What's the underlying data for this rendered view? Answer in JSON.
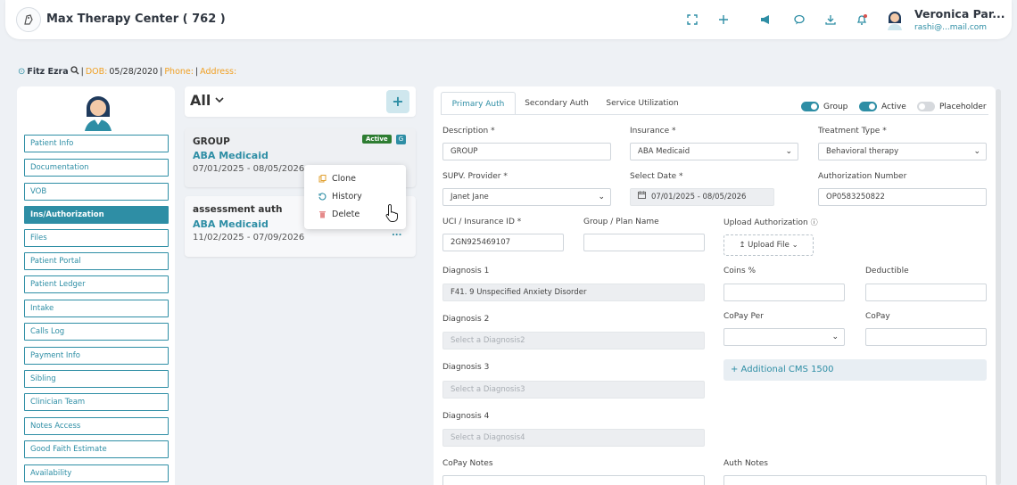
{
  "app": {
    "title": "Max Therapy Center ( 762 )"
  },
  "user": {
    "name": "Veronica Par...",
    "email": "rashi@...mail.com"
  },
  "patient": {
    "name": "Fitz Ezra",
    "dob_label": "DOB:",
    "dob": "05/28/2020",
    "sep": "|",
    "phone_label": "Phone:",
    "address_label": "Address:"
  },
  "nav": [
    "Patient Info",
    "Documentation",
    "VOB",
    "Ins/Authorization",
    "Files",
    "Patient Portal",
    "Patient Ledger",
    "Intake",
    "Calls Log",
    "Payment Info",
    "Sibling",
    "Clinician Team",
    "Notes Access",
    "Good Faith Estimate",
    "Availability"
  ],
  "filter": {
    "label": "All",
    "add": "+"
  },
  "cards": [
    {
      "title": "GROUP",
      "insurance": "ABA Medicaid",
      "dates": "07/01/2025 - 08/05/2026",
      "badge": "Active",
      "g": "G"
    },
    {
      "title": "assessment auth",
      "insurance": "ABA Medicaid",
      "dates": "11/02/2025 - 07/09/2026",
      "more": "..."
    }
  ],
  "context_menu": [
    "Clone",
    "History",
    "Delete"
  ],
  "tabs": [
    "Primary Auth",
    "Secondary Auth",
    "Service Utilization"
  ],
  "toggles": {
    "group": "Group",
    "active": "Active",
    "placeholder": "Placeholder"
  },
  "form": {
    "description": {
      "label": "Description",
      "value": "GROUP"
    },
    "insurance": {
      "label": "Insurance",
      "value": "ABA Medicaid"
    },
    "treatment_type": {
      "label": "Treatment Type",
      "value": "Behavioral therapy"
    },
    "supv_provider": {
      "label": "SUPV. Provider",
      "value": "Janet Jane"
    },
    "select_date": {
      "label": "Select Date",
      "value": "07/01/2025 - 08/05/2026"
    },
    "auth_number": {
      "label": "Authorization Number",
      "value": "OP0583250822"
    },
    "uci": {
      "label": "UCI / Insurance ID",
      "value": "2GN925469107"
    },
    "group_plan": {
      "label": "Group / Plan Name",
      "value": ""
    },
    "upload": {
      "label": "Upload Authorization",
      "button": "Upload File"
    },
    "diagnosis1": {
      "label": "Diagnosis 1",
      "value": "F41. 9 Unspecified Anxiety Disorder"
    },
    "coins": {
      "label": "Coins %",
      "value": ""
    },
    "deductible": {
      "label": "Deductible",
      "value": ""
    },
    "diagnosis2": {
      "label": "Diagnosis 2",
      "placeholder": "Select a Diagnosis2"
    },
    "copay_per": {
      "label": "CoPay Per",
      "value": ""
    },
    "copay": {
      "label": "CoPay",
      "value": ""
    },
    "diagnosis3": {
      "label": "Diagnosis 3",
      "placeholder": "Select a Diagnosis3"
    },
    "additional_cms": "+ Additional CMS 1500",
    "diagnosis4": {
      "label": "Diagnosis 4",
      "placeholder": "Select a Diagnosis4"
    },
    "copay_notes": {
      "label": "CoPay Notes"
    },
    "auth_notes": {
      "label": "Auth Notes"
    }
  }
}
